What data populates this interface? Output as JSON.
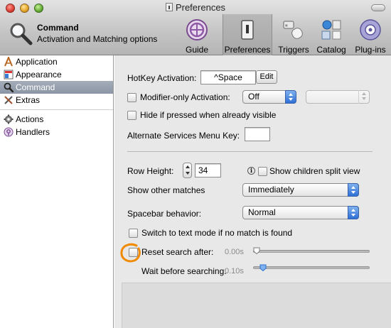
{
  "window": {
    "title": "Preferences",
    "header_title": "Command",
    "header_subtitle": "Activation and Matching options"
  },
  "toolbar": {
    "items": [
      {
        "label": "Guide",
        "icon": "guide-icon"
      },
      {
        "label": "Preferences",
        "icon": "preferences-icon",
        "selected": true
      },
      {
        "label": "Triggers",
        "icon": "triggers-icon"
      },
      {
        "label": "Catalog",
        "icon": "catalog-icon"
      },
      {
        "label": "Plug-ins",
        "icon": "plugins-icon"
      }
    ]
  },
  "sidebar": {
    "items": [
      {
        "label": "Application",
        "icon": "application-icon"
      },
      {
        "label": "Appearance",
        "icon": "appearance-icon"
      },
      {
        "label": "Command",
        "icon": "magnifier-icon",
        "selected": true
      },
      {
        "label": "Extras",
        "icon": "extras-icon"
      },
      {
        "label": "Actions",
        "icon": "gear-icon"
      },
      {
        "label": "Handlers",
        "icon": "handlers-icon"
      }
    ]
  },
  "main": {
    "hotkey_label": "HotKey Activation:",
    "hotkey_value": "^Space",
    "edit_button": "Edit",
    "modifier_only_label": "Modifier-only Activation:",
    "modifier_only_value": "Off",
    "modifier_only_checked": false,
    "hide_if_pressed_label": "Hide if pressed when already visible",
    "hide_if_pressed_checked": false,
    "alt_services_label": "Alternate Services Menu Key:",
    "alt_services_value": "",
    "row_height_label": "Row Height:",
    "row_height_value": "34",
    "show_children_label": "Show children split view",
    "show_children_checked": false,
    "show_other_label": "Show other matches",
    "show_other_value": "Immediately",
    "spacebar_label": "Spacebar behavior:",
    "spacebar_value": "Normal",
    "switch_text_label": "Switch to text mode if no match is found",
    "switch_text_checked": false,
    "reset_search_label": "Reset search after:",
    "reset_search_checked": false,
    "reset_search_value": "0.00s",
    "reset_search_level": 0.0,
    "wait_label": "Wait before searching:",
    "wait_value": "0.10s",
    "wait_level": 0.06
  },
  "colors": {
    "selection": "#8b95a5",
    "popup_blue": "#2d6fd6",
    "annotation_orange": "#f08a00"
  }
}
